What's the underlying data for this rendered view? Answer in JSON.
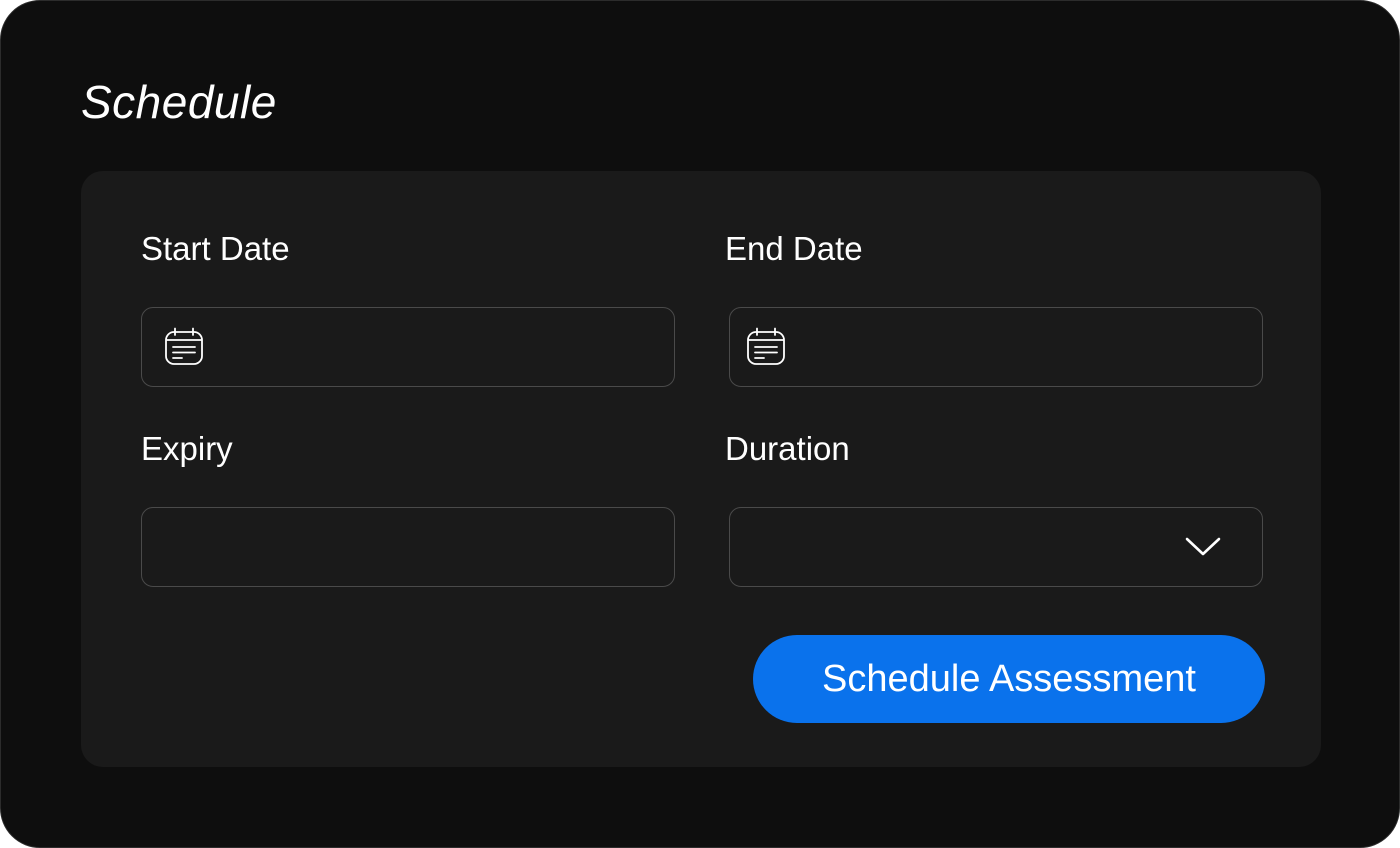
{
  "page": {
    "title": "Schedule"
  },
  "form": {
    "start_date": {
      "label": "Start Date",
      "value": "",
      "placeholder": "",
      "icon": "calendar-icon"
    },
    "end_date": {
      "label": "End Date",
      "value": "",
      "placeholder": "",
      "icon": "calendar-icon"
    },
    "expiry": {
      "label": "Expiry",
      "value": "",
      "placeholder": ""
    },
    "duration": {
      "label": "Duration",
      "selected": "",
      "icon": "chevron-down-icon"
    },
    "submit_label": "Schedule Assessment"
  },
  "colors": {
    "background": "#0e0e0e",
    "card": "#1a1a1a",
    "field_border": "#4a4a4a",
    "text": "#ffffff",
    "accent": "#0a72ec"
  }
}
